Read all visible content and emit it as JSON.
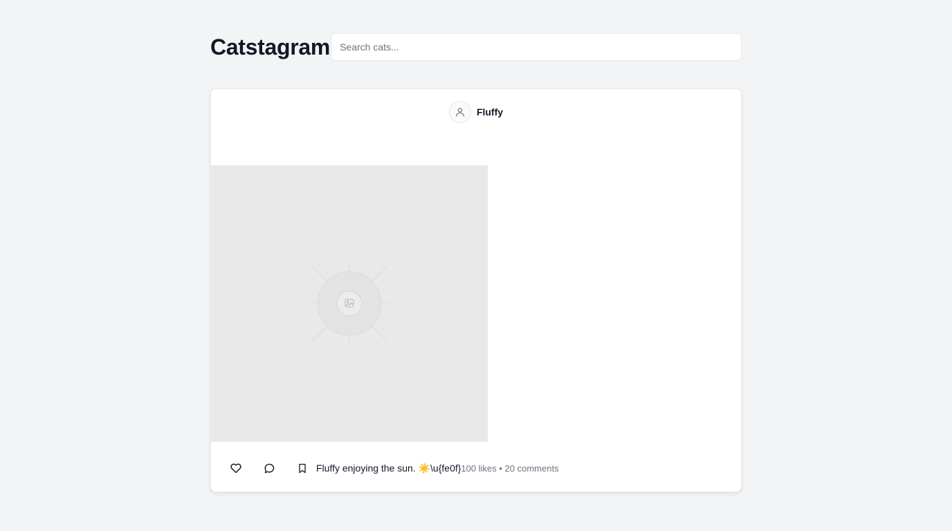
{
  "header": {
    "title": "Catstagram",
    "search_placeholder": "Search cats..."
  },
  "post": {
    "username": "Fluffy",
    "more_label": "...",
    "image_icon": "image-placeholder-icon",
    "caption": "Fluffy enjoying the sun. ☀️\\u{fe0f}",
    "likes_text": "100 likes",
    "separator": "•",
    "comments_text": "20 comments",
    "actions": {
      "like_icon": "heart-icon",
      "comment_icon": "comment-icon",
      "bookmark_icon": "bookmark-icon"
    }
  },
  "colors": {
    "background": "#f3f4f6",
    "card": "#ffffff",
    "text": "#111827",
    "muted": "#6b7280",
    "placeholder_bg": "#e9e9e9"
  }
}
